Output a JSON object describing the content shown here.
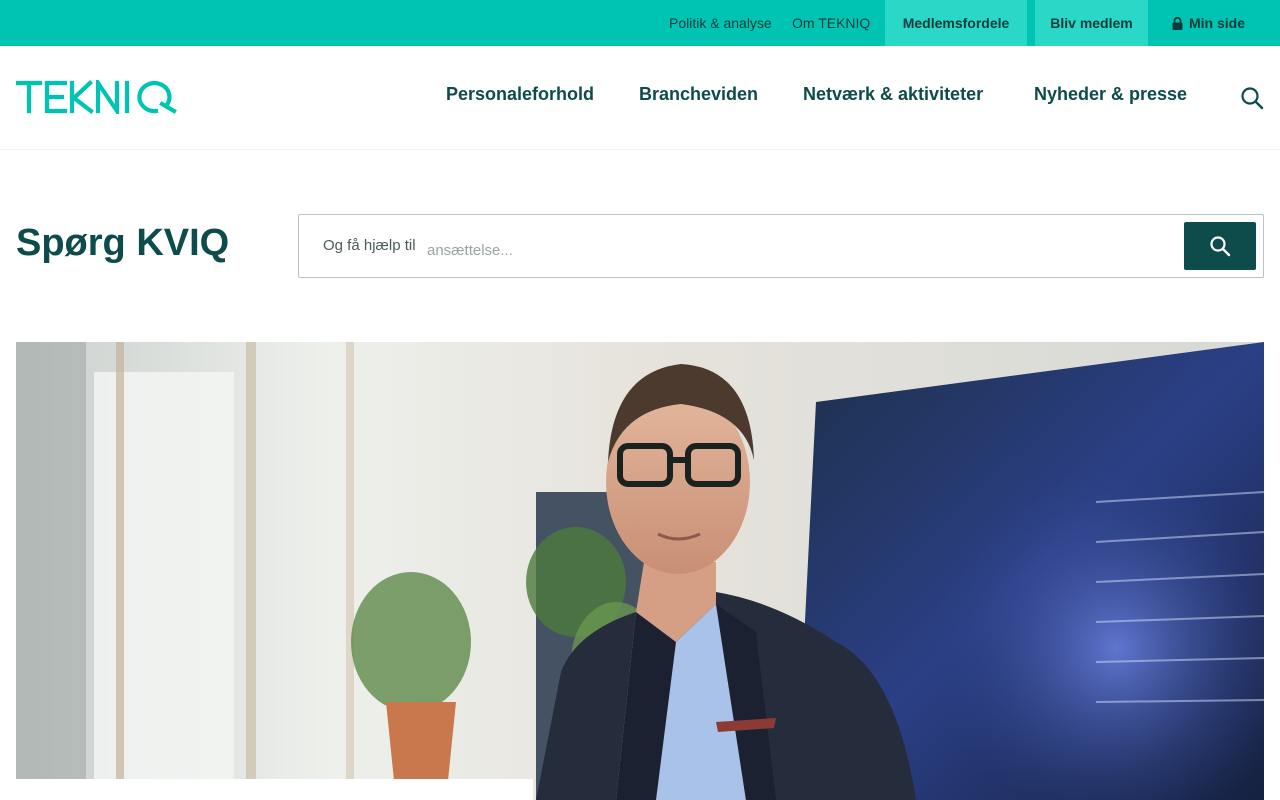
{
  "topbar": {
    "politik_label": "Politik & analyse",
    "om_label": "Om TEKNIQ",
    "medlemsfordele_label": "Medlemsfordele",
    "bliv_medlem_label": "Bliv medlem",
    "min_side_label": "Min side",
    "lock_icon": "lock-icon"
  },
  "header": {
    "logo_text": "TEKNIQ",
    "nav": {
      "personaleforhold": "Personaleforhold",
      "brancheviden": "Brancheviden",
      "netvaerk": "Netværk & aktiviteter",
      "nyheder": "Nyheder & presse"
    },
    "search_icon": "search-icon"
  },
  "ask": {
    "title": "Spørg KVIQ",
    "prefix": "Og få hjælp til",
    "placeholder": "ansættelse...",
    "submit_icon": "search-icon"
  },
  "hero": {
    "alt": "Portrait of a man in glasses and a dark blazer in an office"
  },
  "colors": {
    "accent": "#00c4b3",
    "accent_light": "#2ad8c8",
    "primary_dark": "#0e4b4b"
  }
}
